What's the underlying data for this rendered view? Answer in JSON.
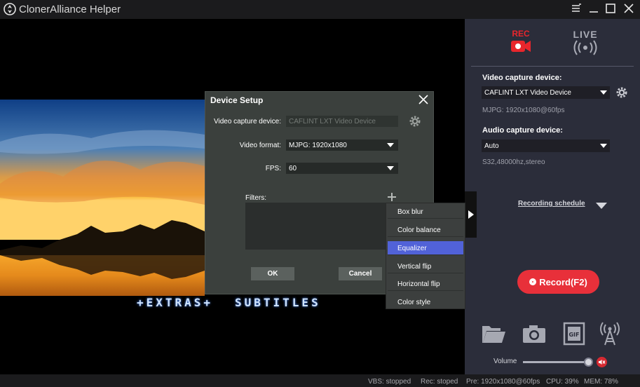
{
  "window": {
    "title": "ClonerAlliance Helper"
  },
  "preview": {
    "extras_text": "+EXTRAS+",
    "subtitles_text": "SUBTITLES"
  },
  "panel": {
    "rec_label": "REC",
    "live_label": "LIVE",
    "video_device_label": "Video capture device:",
    "video_device_value": "CAFLINT LXT Video Device",
    "video_device_info": "MJPG: 1920x1080@60fps",
    "audio_device_label": "Audio capture device:",
    "audio_device_value": "Auto",
    "audio_device_info": "S32,48000hz,stereo",
    "recording_schedule": "Recording schedule",
    "record_button": "Record(F2)",
    "volume_label": "Volume",
    "volume_level_percent": 95,
    "accent_color": "#e8303a"
  },
  "dialog": {
    "title": "Device Setup",
    "video_device_label": "Video capture device:",
    "video_device_value": "CAFLINT LXT Video Device",
    "video_format_label": "Video format:",
    "video_format_value": "MJPG: 1920x1080",
    "fps_label": "FPS:",
    "fps_value": "60",
    "filters_label": "Filters:",
    "ok_label": "OK",
    "cancel_label": "Cancel"
  },
  "filter_menu": {
    "items": [
      {
        "label": "Box blur"
      },
      {
        "label": "Color balance"
      },
      {
        "label": "Equalizer",
        "selected": true
      },
      {
        "label": "Vertical flip"
      },
      {
        "label": "Horizontal flip"
      },
      {
        "label": "Color style"
      }
    ],
    "selected_color": "#5162d8"
  },
  "status": {
    "vbs": "VBS: stopped",
    "rec": "Rec: stoped",
    "pre": "Pre: 1920x1080@60fps",
    "cpu": "CPU: 39%",
    "mem": "MEM: 78%"
  }
}
